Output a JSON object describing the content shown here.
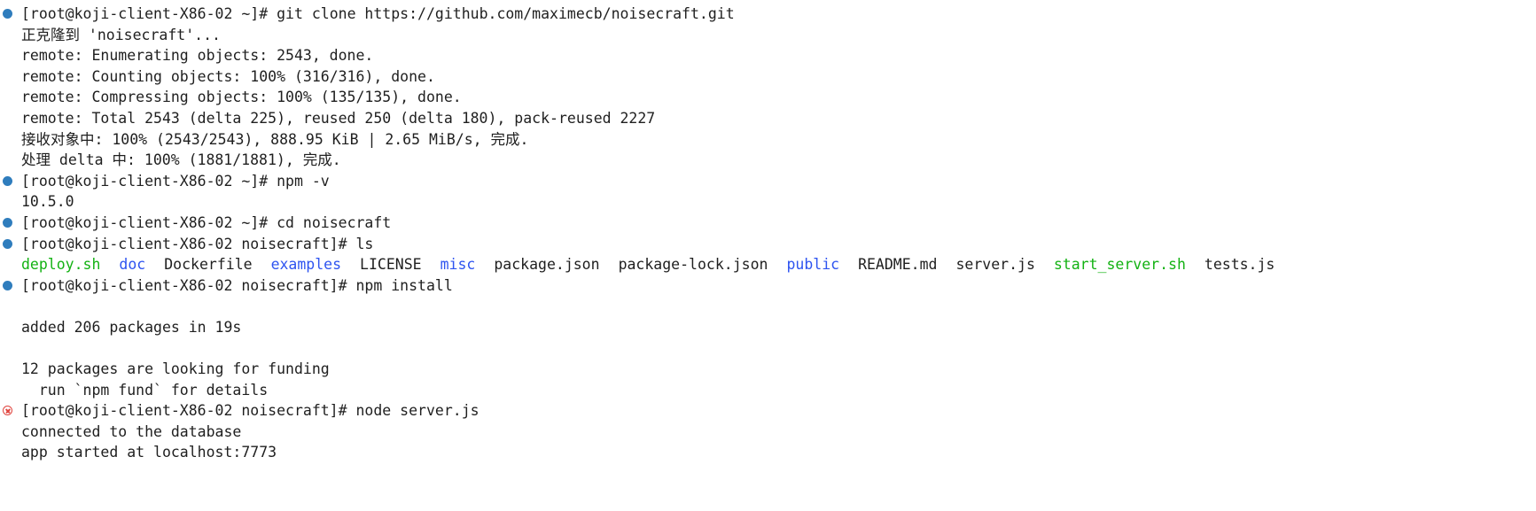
{
  "terminal": {
    "lines": [
      {
        "type": "prompt",
        "status": "ok",
        "prompt": "[root@koji-client-X86-02 ~]# ",
        "command": "git clone https://github.com/maximecb/noisecraft.git"
      },
      {
        "type": "output",
        "text": "正克隆到 'noisecraft'..."
      },
      {
        "type": "output",
        "text": "remote: Enumerating objects: 2543, done."
      },
      {
        "type": "output",
        "text": "remote: Counting objects: 100% (316/316), done."
      },
      {
        "type": "output",
        "text": "remote: Compressing objects: 100% (135/135), done."
      },
      {
        "type": "output",
        "text": "remote: Total 2543 (delta 225), reused 250 (delta 180), pack-reused 2227"
      },
      {
        "type": "output",
        "text": "接收对象中: 100% (2543/2543), 888.95 KiB | 2.65 MiB/s, 完成."
      },
      {
        "type": "output",
        "text": "处理 delta 中: 100% (1881/1881), 完成."
      },
      {
        "type": "prompt",
        "status": "ok",
        "prompt": "[root@koji-client-X86-02 ~]# ",
        "command": "npm -v"
      },
      {
        "type": "output",
        "text": "10.5.0"
      },
      {
        "type": "prompt",
        "status": "ok",
        "prompt": "[root@koji-client-X86-02 ~]# ",
        "command": "cd noisecraft"
      },
      {
        "type": "prompt",
        "status": "ok",
        "prompt": "[root@koji-client-X86-02 noisecraft]# ",
        "command": "ls"
      },
      {
        "type": "ls",
        "entries": [
          {
            "name": "deploy.sh",
            "kind": "exec"
          },
          {
            "name": "doc",
            "kind": "dir"
          },
          {
            "name": "Dockerfile",
            "kind": "file"
          },
          {
            "name": "examples",
            "kind": "dir"
          },
          {
            "name": "LICENSE",
            "kind": "file"
          },
          {
            "name": "misc",
            "kind": "dir"
          },
          {
            "name": "package.json",
            "kind": "file"
          },
          {
            "name": "package-lock.json",
            "kind": "file"
          },
          {
            "name": "public",
            "kind": "dir"
          },
          {
            "name": "README.md",
            "kind": "file"
          },
          {
            "name": "server.js",
            "kind": "file"
          },
          {
            "name": "start_server.sh",
            "kind": "exec"
          },
          {
            "name": "tests.js",
            "kind": "file"
          }
        ]
      },
      {
        "type": "prompt",
        "status": "ok",
        "prompt": "[root@koji-client-X86-02 noisecraft]# ",
        "command": "npm install"
      },
      {
        "type": "output",
        "text": ""
      },
      {
        "type": "output",
        "text": "added 206 packages in 19s"
      },
      {
        "type": "output",
        "text": ""
      },
      {
        "type": "output",
        "text": "12 packages are looking for funding"
      },
      {
        "type": "output",
        "text": "  run `npm fund` for details"
      },
      {
        "type": "prompt",
        "status": "error",
        "prompt": "[root@koji-client-X86-02 noisecraft]# ",
        "command": "node server.js"
      },
      {
        "type": "output",
        "text": "connected to the database"
      },
      {
        "type": "output",
        "text": "app started at localhost:7773"
      }
    ]
  },
  "colors": {
    "background": "#ffffff",
    "text": "#1f1f1f",
    "executable": "#13b213",
    "directory": "#2e54f0",
    "status_ok": "#2f7dbd",
    "status_error": "#e0443e"
  }
}
